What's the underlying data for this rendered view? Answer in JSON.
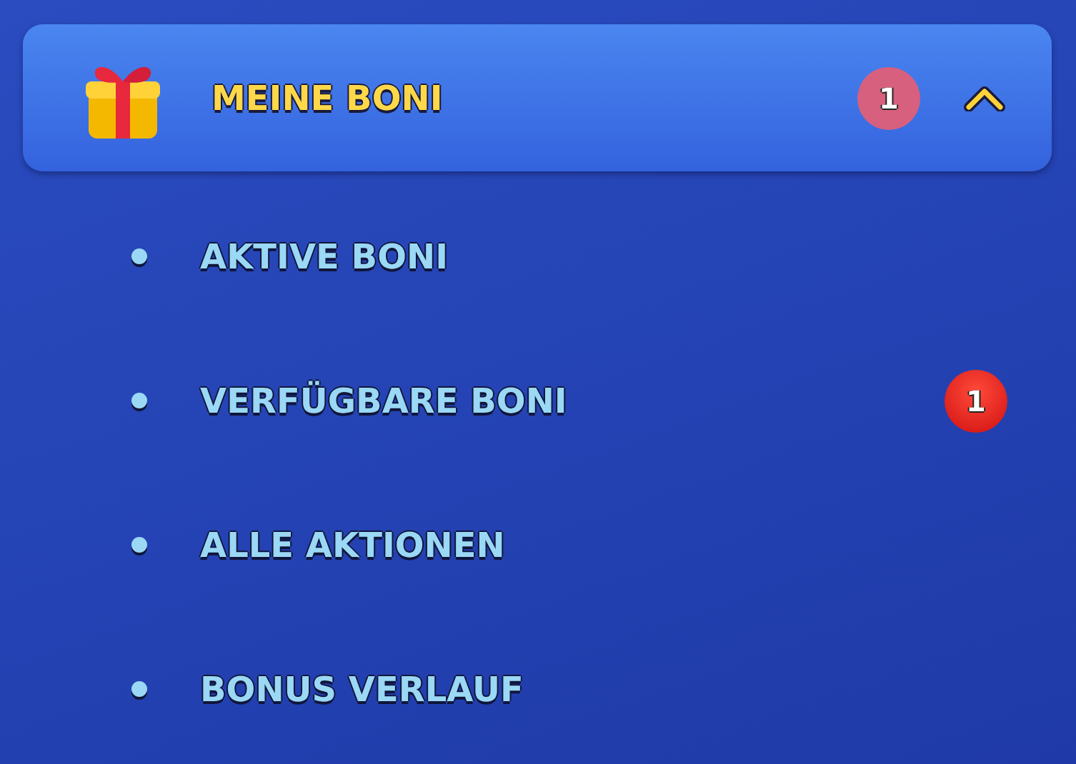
{
  "section": {
    "title": "MEINE BONI",
    "badge": "1",
    "expanded": true
  },
  "items": [
    {
      "label": "AKTIVE BONI"
    },
    {
      "label": "VERFÜGBARE BONI",
      "badge": "1"
    },
    {
      "label": "ALLE AKTIONEN"
    },
    {
      "label": "BONUS VERLAUF"
    }
  ]
}
